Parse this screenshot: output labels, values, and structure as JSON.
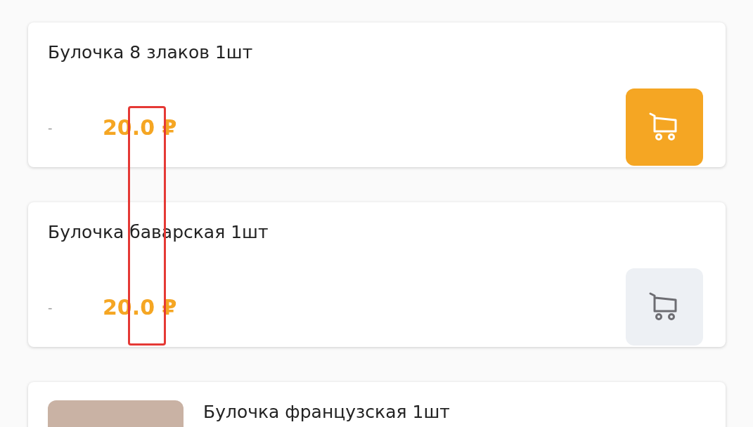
{
  "products": [
    {
      "name": "Булочка 8 злаков 1шт",
      "has_photo": false,
      "old_price": "-",
      "price": "20.0 ₽",
      "in_cart": true
    },
    {
      "name": "Булочка баварская 1шт",
      "has_photo": false,
      "old_price": "-",
      "price": "20.0 ₽",
      "in_cart": false
    },
    {
      "name": "Булочка французская 1шт",
      "has_photo": true
    }
  ]
}
